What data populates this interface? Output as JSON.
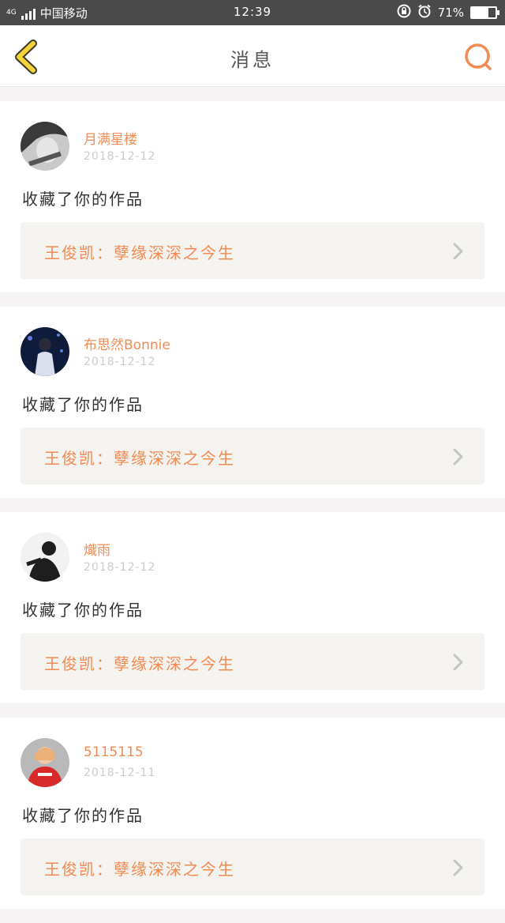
{
  "status": {
    "network": "4G",
    "carrier": "中国移动",
    "time": "12:39",
    "battery": "71%",
    "battery_level": 0.71
  },
  "header": {
    "title": "消息",
    "back_icon": "chevron-left-icon",
    "search_icon": "search-icon"
  },
  "notifications": [
    {
      "user": "月满星楼",
      "date": "2018-12-12",
      "action": "收藏了你的作品",
      "work": "王俊凯：孽缘深深之今生"
    },
    {
      "user": "布思然Bonnie",
      "date": "2018-12-12",
      "action": "收藏了你的作品",
      "work": "王俊凯：孽缘深深之今生"
    },
    {
      "user": "熾雨",
      "date": "2018-12-12",
      "action": "收藏了你的作品",
      "work": "王俊凯：孽缘深深之今生"
    },
    {
      "user": "5115115",
      "date": "2018-12-11",
      "action": "收藏了你的作品",
      "work": "王俊凯：孽缘深深之今生"
    }
  ],
  "colors": {
    "accent": "#f08b53",
    "back_icon": "#f5d33a",
    "status_bar": "#4a4a4a"
  }
}
